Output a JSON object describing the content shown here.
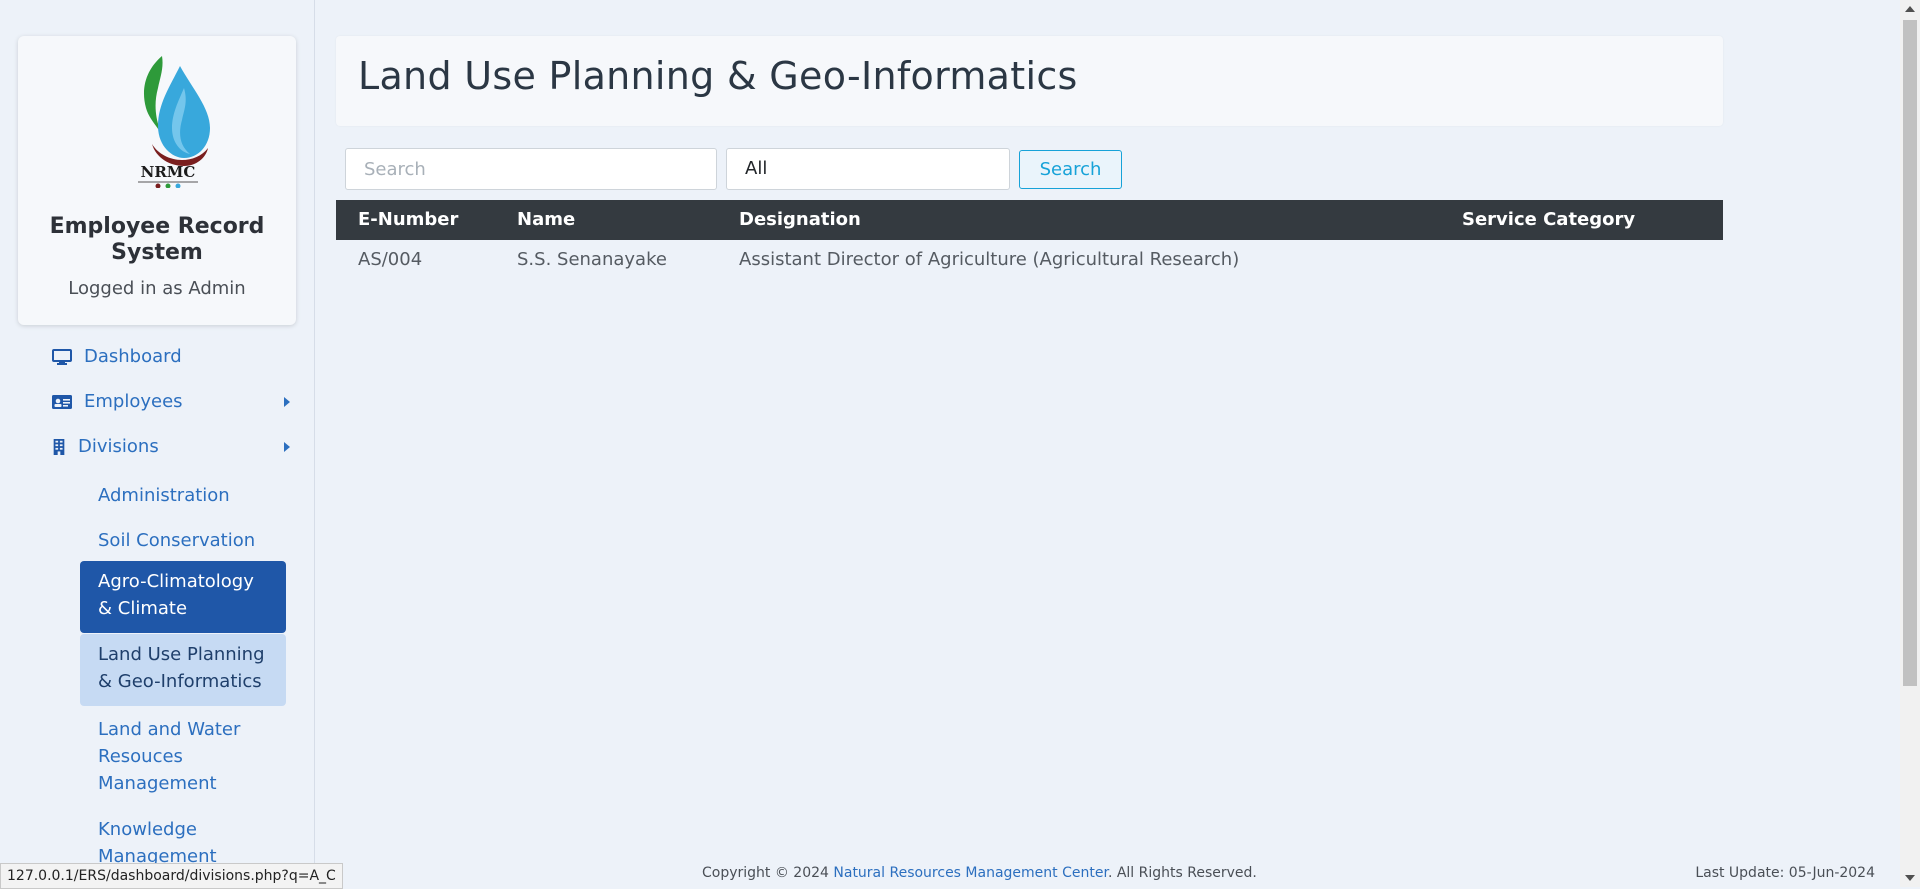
{
  "sidebar": {
    "brand_title": "Employee Record System",
    "logged_in": "Logged in as Admin",
    "logo_text": "NRMC",
    "nav": [
      {
        "label": "Dashboard",
        "icon": "monitor-icon"
      },
      {
        "label": "Employees",
        "icon": "id-card-icon"
      },
      {
        "label": "Divisions",
        "icon": "building-icon"
      }
    ],
    "divisions": [
      "Administration",
      "Soil Conservation",
      "Agro-Climatology & Climate",
      "Land Use Planning & Geo-Informatics",
      "Land and Water Resouces Management",
      "Knowledge Management"
    ]
  },
  "main": {
    "title": "Land Use Planning & Geo-Informatics",
    "search_placeholder": "Search",
    "filter_value": "All",
    "search_button": "Search",
    "table": {
      "headers": [
        "E-Number",
        "Name",
        "Designation",
        "Service Category"
      ],
      "rows": [
        [
          "AS/004",
          "S.S. Senanayake",
          "Assistant Director of Agriculture (Agricultural Research)",
          ""
        ]
      ]
    }
  },
  "footer": {
    "copyright_prefix": "Copyright © 2024 ",
    "org_link": "Natural Resources Management Center",
    "copyright_suffix": ". All Rights Reserved.",
    "last_update": "Last Update: 05-Jun-2024"
  },
  "status_url": "127.0.0.1/ERS/dashboard/divisions.php?q=A_C",
  "colors": {
    "accent": "#2c6fbf",
    "active_dark": "#1f57a8",
    "active_light": "#c6daf3",
    "table_header": "#343a40",
    "search_button": "#17a2d8"
  }
}
